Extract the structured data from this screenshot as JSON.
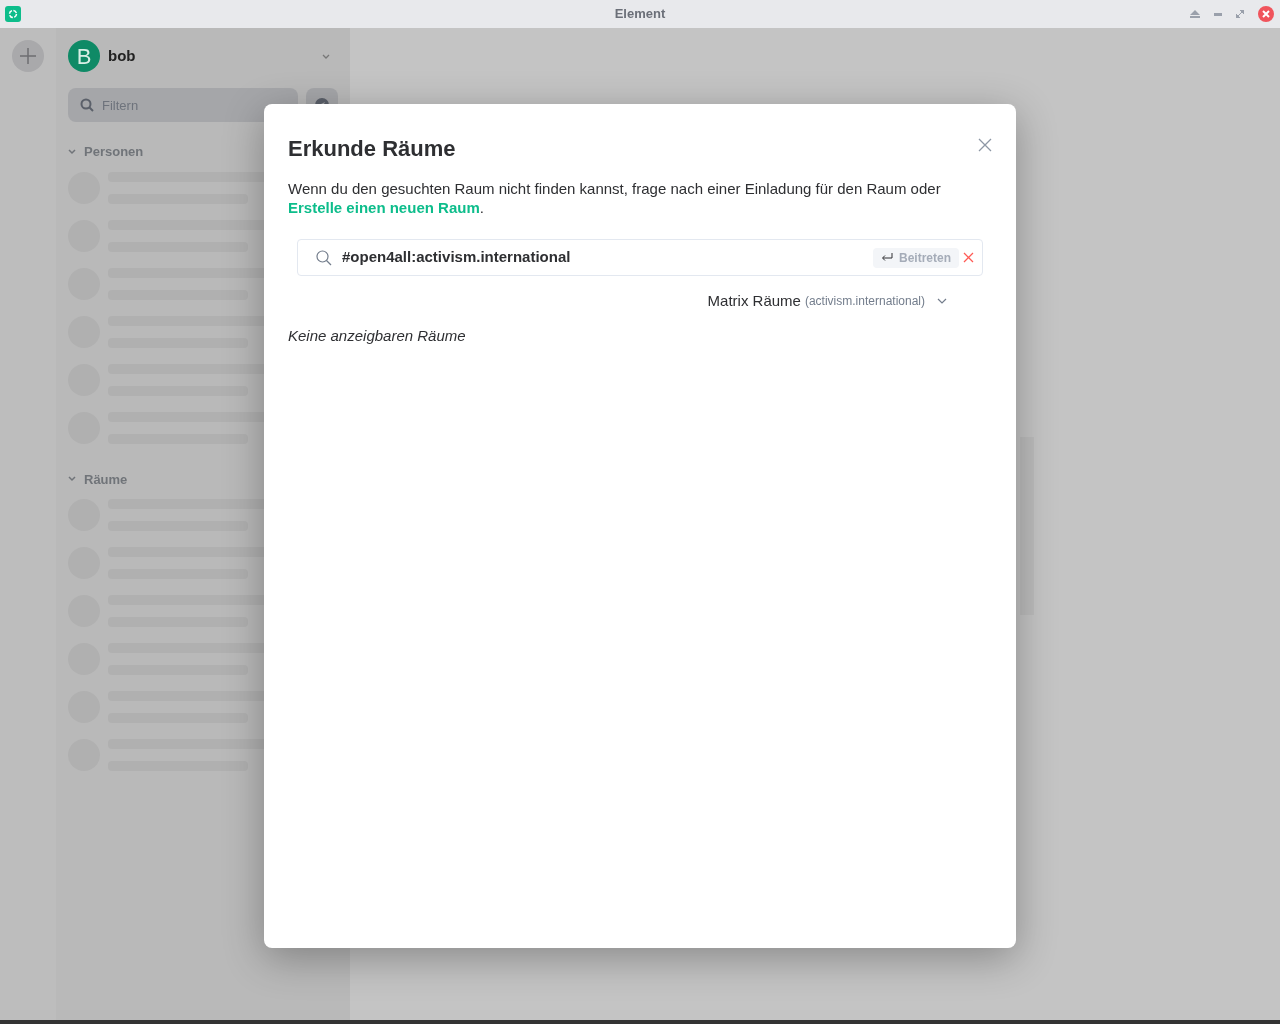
{
  "window": {
    "title": "Element"
  },
  "user": {
    "initial": "B",
    "name": "bob"
  },
  "filter": {
    "placeholder": "Filtern"
  },
  "sections": [
    {
      "label": "Personen",
      "expanded": true
    },
    {
      "label": "Räume",
      "expanded": true
    }
  ],
  "dialog": {
    "title": "Erkunde Räume",
    "description": "Wenn du den gesuchten Raum nicht finden kannst, frage nach einer Einladung für den Raum oder",
    "create_link": "Erstelle einen neuen Raum",
    "description_end": ".",
    "search": {
      "value": "#open4all:activism.international"
    },
    "join_button": "Beitreten",
    "server_picker": {
      "label": "Matrix Räume",
      "server": "(activism.international)"
    },
    "empty_message": "Keine anzeigbaren Räume"
  }
}
